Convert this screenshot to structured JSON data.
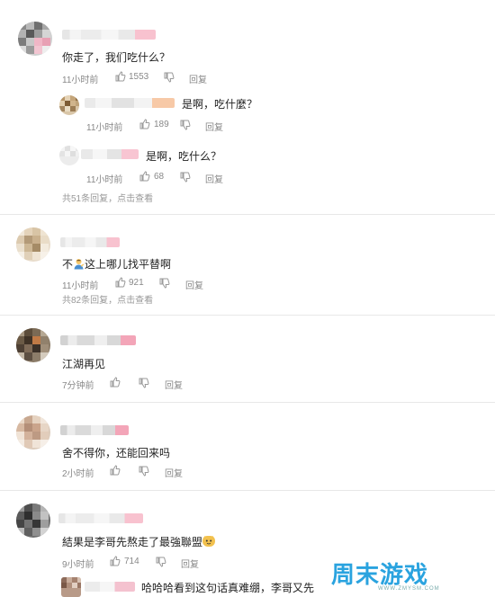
{
  "comments": [
    {
      "text": "你走了，我们吃什么？",
      "time": "11小时前",
      "likes": "1553",
      "reply_label": "回复",
      "replies": [
        {
          "text": "是啊，吃什麼？",
          "time": "11小时前",
          "likes": "189",
          "reply_label": "回复"
        },
        {
          "text": "是啊，吃什么？",
          "time": "11小时前",
          "likes": "68",
          "reply_label": "回复"
        }
      ],
      "more_replies": "共51条回复，点击查看"
    },
    {
      "text_pre": "不",
      "text_post": "这上哪儿找平替啊",
      "time": "11小时前",
      "likes": "921",
      "reply_label": "回复",
      "more_replies": "共82条回复，点击查看"
    },
    {
      "text": "江湖再见",
      "time": "7分钟前",
      "reply_label": "回复"
    },
    {
      "text": "舍不得你，还能回来吗",
      "time": "2小时前",
      "reply_label": "回复"
    },
    {
      "text": "結果是李哥先熬走了最強聯盟",
      "time": "9小时前",
      "likes": "714",
      "reply_label": "回复"
    }
  ],
  "partial_reply": {
    "text": "哈哈哈看到这句话真难绷，李哥又先"
  },
  "watermark": {
    "main": "周末",
    "accent": "游戏",
    "url": "WWW.ZMYSM.COM"
  },
  "icons": [
    "thumbs-up-icon",
    "thumbs-down-icon",
    "person-emoji",
    "cat-emoji"
  ]
}
